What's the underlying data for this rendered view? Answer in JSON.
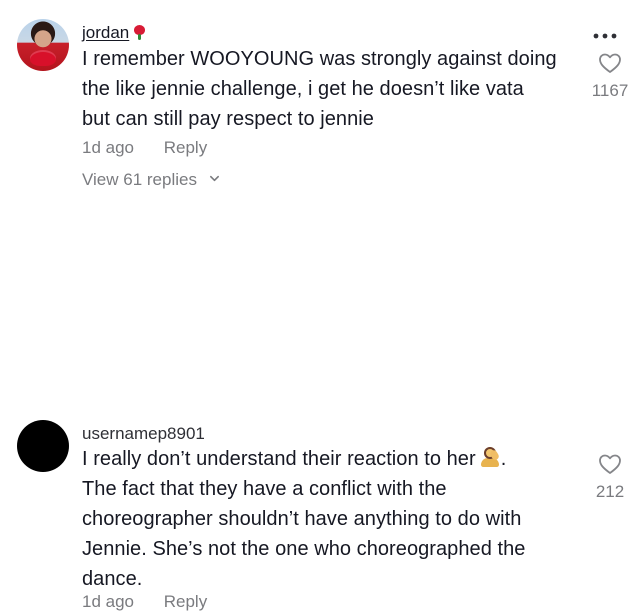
{
  "comments": [
    {
      "username": "jordan",
      "text_lines": [
        "I remember WOOYOUNG was strongly against doing",
        "the like jennie challenge, i get he doesn’t like vata",
        "but can still pay respect to jennie"
      ],
      "time": "1d ago",
      "reply_label": "Reply",
      "view_replies": "View 61 replies",
      "likes": "1167"
    },
    {
      "username": "usernamep8901",
      "text_lines": [
        "I really don’t understand their reaction to her",
        "The fact that they have a conflict with the",
        "choreographer shouldn’t have anything to do with",
        "Jennie. She’s not the one who choreographed the",
        "dance."
      ],
      "emoji_suffix": ".",
      "time": "1d ago",
      "reply_label": "Reply",
      "likes": "212"
    }
  ],
  "icons": {
    "more": "more-horizontal-icon",
    "like": "heart-outline-icon",
    "expand": "chevron-down-icon",
    "username_emoji": "rose-icon",
    "text_emoji": "person-facepalming-icon"
  }
}
